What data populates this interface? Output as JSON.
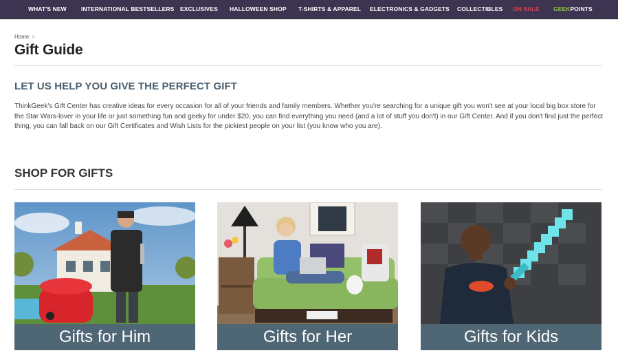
{
  "nav": {
    "items": [
      "WHAT'S NEW",
      "INTERNATIONAL BESTSELLERS",
      "EXCLUSIVES",
      "HALLOWEEN SHOP",
      "T-SHIRTS & APPAREL",
      "ELECTRONICS & GADGETS",
      "COLLECTIBLES"
    ],
    "on_sale": "ON SALE",
    "geek": "GEEK",
    "points": "POINTS"
  },
  "breadcrumb": {
    "home": "Home",
    "sep": ">"
  },
  "page_title": "Gift Guide",
  "help": {
    "heading": "LET US HELP YOU GIVE THE PERFECT GIFT",
    "body": "ThinkGeek's Gift Center has creative ideas for every occasion for all of your friends and family members. Whether you're searching for a unique gift you won't see at your local big box store for the Star Wars-lover in your life or just something fun and geeky for under $20, you can find everything you need (and a lot of stuff you don't) in our Gift Center. And if you don't find just the perfect thing, you can fall back on our Gift Certificates and Wish Lists for the pickiest people on your list (you know who you are)."
  },
  "shop": {
    "heading": "SHOP FOR GIFTS",
    "cards": [
      {
        "label": "Gifts for Him"
      },
      {
        "label": "Gifts for Her"
      },
      {
        "label": "Gifts for Kids"
      }
    ]
  },
  "colors": {
    "nav_bg": "#3c3450",
    "sale": "#e1434b",
    "geek": "#8cc63f",
    "heading": "#4a5f6e",
    "card_label": "#4f6675"
  }
}
